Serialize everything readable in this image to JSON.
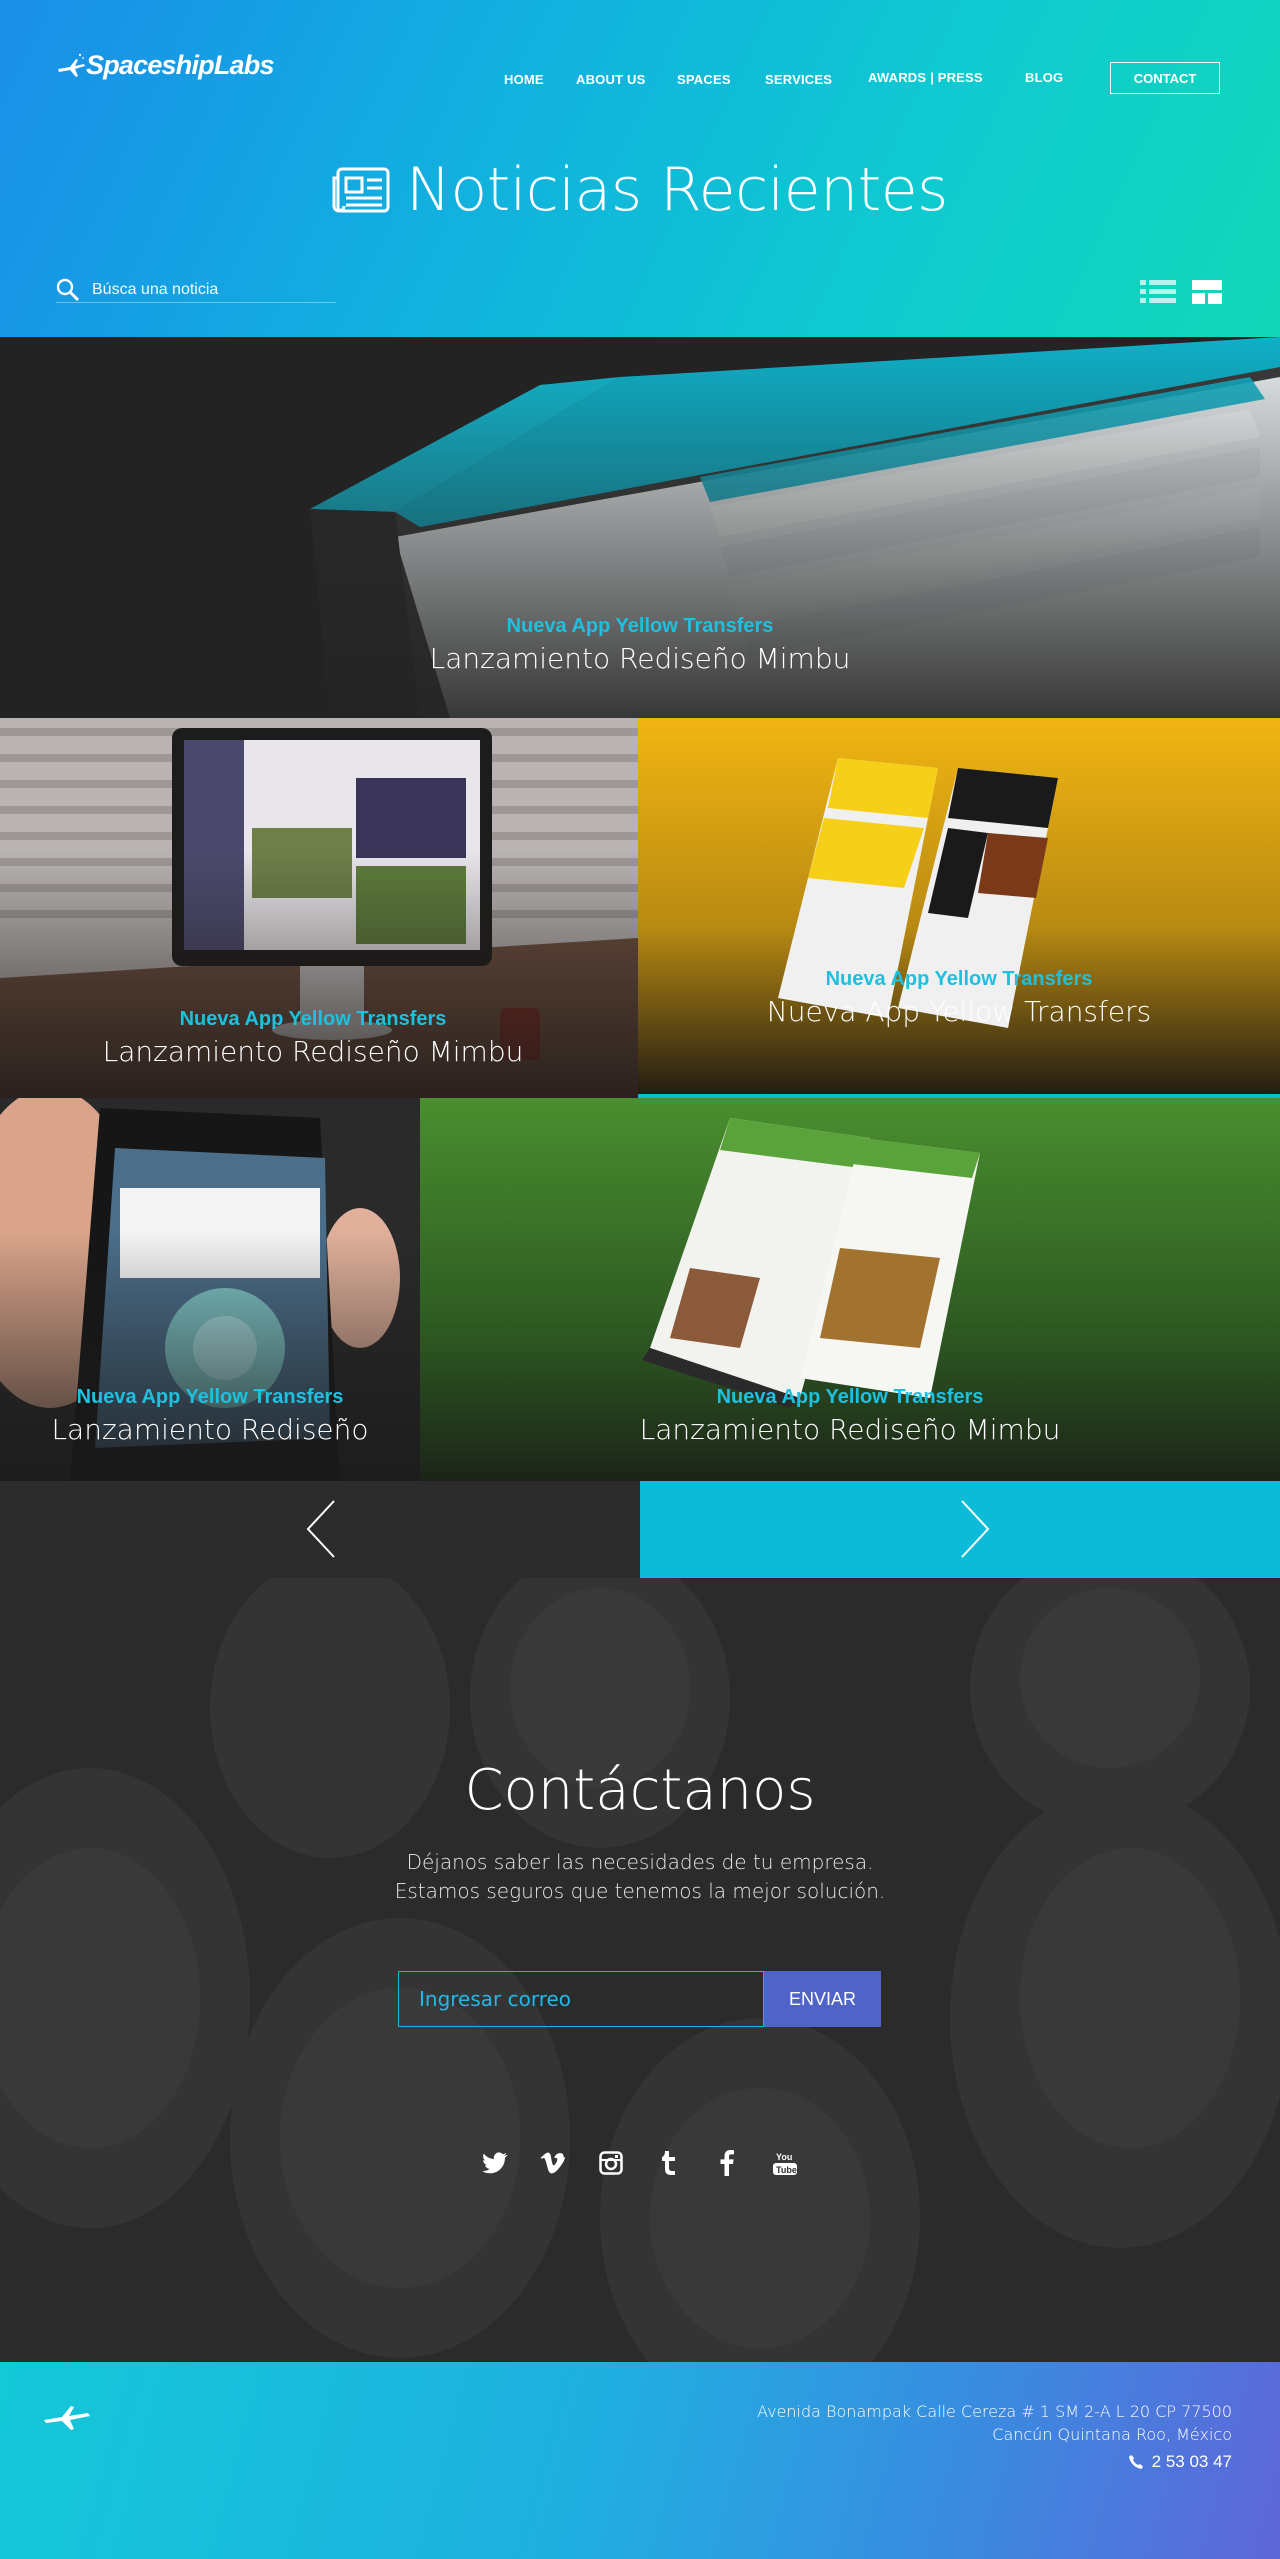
{
  "brand": {
    "name": "SpaceshipLabs"
  },
  "nav": {
    "items": [
      "HOME",
      "ABOUT US",
      "SPACES",
      "SERVICES",
      "AWARDS | PRESS",
      "BLOG"
    ],
    "contact": "CONTACT"
  },
  "page": {
    "title": "Noticias Recientes"
  },
  "search": {
    "placeholder": "Búsca una noticia"
  },
  "tiles": [
    {
      "kicker": "Nueva App Yellow Transfers",
      "title": "Lanzamiento Rediseño Mimbu"
    },
    {
      "kicker": "Nueva App Yellow Transfers",
      "title": "Lanzamiento Rediseño Mimbu"
    },
    {
      "kicker": "Nueva App Yellow Transfers",
      "title": "Nueva App Yellow Transfers"
    },
    {
      "kicker": "Nueva App Yellow Transfers",
      "title": "Lanzamiento Rediseño"
    },
    {
      "kicker": "Nueva App Yellow Transfers",
      "title": "Lanzamiento Rediseño Mimbu"
    }
  ],
  "contact": {
    "title": "Contáctanos",
    "line1": "Déjanos saber las necesidades de tu empresa.",
    "line2": "Estamos seguros que tenemos la mejor solución.",
    "email_placeholder": "Ingresar correo",
    "send": "ENVIAR"
  },
  "social": [
    "twitter-icon",
    "vimeo-icon",
    "instagram-icon",
    "tumblr-icon",
    "facebook-icon",
    "youtube-icon"
  ],
  "footer": {
    "address1": "Avenida Bonampak Calle Cereza # 1 SM 2-A L 20 CP 77500",
    "address2": "Cancún Quintana Roo, México",
    "phone": "2 53 03 47"
  },
  "colors": {
    "accent": "#0bbbd8",
    "button": "#4f63c8",
    "kicker": "#1ec0df"
  }
}
